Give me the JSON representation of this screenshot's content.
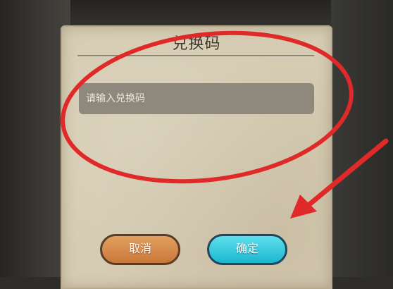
{
  "dialog": {
    "title": "兑换码",
    "input": {
      "placeholder": "请输入兑换码",
      "value": ""
    },
    "buttons": {
      "cancel": "取消",
      "confirm": "确定"
    }
  },
  "annotation": {
    "color": "#e02a2a"
  }
}
